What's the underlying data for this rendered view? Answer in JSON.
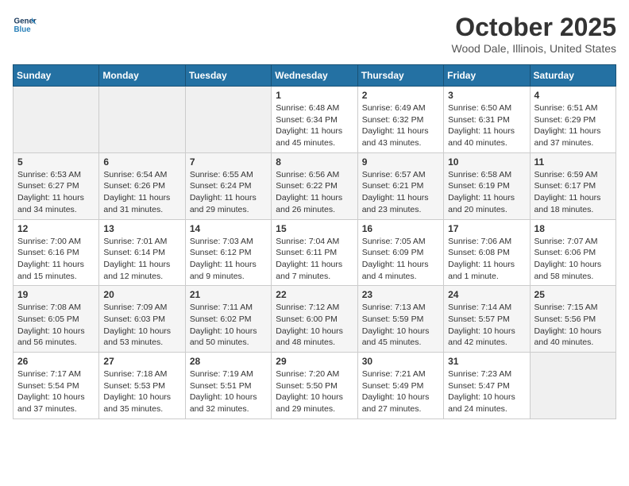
{
  "header": {
    "logo_line1": "General",
    "logo_line2": "Blue",
    "month_title": "October 2025",
    "location": "Wood Dale, Illinois, United States"
  },
  "days_of_week": [
    "Sunday",
    "Monday",
    "Tuesday",
    "Wednesday",
    "Thursday",
    "Friday",
    "Saturday"
  ],
  "weeks": [
    [
      {
        "day": "",
        "info": ""
      },
      {
        "day": "",
        "info": ""
      },
      {
        "day": "",
        "info": ""
      },
      {
        "day": "1",
        "info": "Sunrise: 6:48 AM\nSunset: 6:34 PM\nDaylight: 11 hours and 45 minutes."
      },
      {
        "day": "2",
        "info": "Sunrise: 6:49 AM\nSunset: 6:32 PM\nDaylight: 11 hours and 43 minutes."
      },
      {
        "day": "3",
        "info": "Sunrise: 6:50 AM\nSunset: 6:31 PM\nDaylight: 11 hours and 40 minutes."
      },
      {
        "day": "4",
        "info": "Sunrise: 6:51 AM\nSunset: 6:29 PM\nDaylight: 11 hours and 37 minutes."
      }
    ],
    [
      {
        "day": "5",
        "info": "Sunrise: 6:53 AM\nSunset: 6:27 PM\nDaylight: 11 hours and 34 minutes."
      },
      {
        "day": "6",
        "info": "Sunrise: 6:54 AM\nSunset: 6:26 PM\nDaylight: 11 hours and 31 minutes."
      },
      {
        "day": "7",
        "info": "Sunrise: 6:55 AM\nSunset: 6:24 PM\nDaylight: 11 hours and 29 minutes."
      },
      {
        "day": "8",
        "info": "Sunrise: 6:56 AM\nSunset: 6:22 PM\nDaylight: 11 hours and 26 minutes."
      },
      {
        "day": "9",
        "info": "Sunrise: 6:57 AM\nSunset: 6:21 PM\nDaylight: 11 hours and 23 minutes."
      },
      {
        "day": "10",
        "info": "Sunrise: 6:58 AM\nSunset: 6:19 PM\nDaylight: 11 hours and 20 minutes."
      },
      {
        "day": "11",
        "info": "Sunrise: 6:59 AM\nSunset: 6:17 PM\nDaylight: 11 hours and 18 minutes."
      }
    ],
    [
      {
        "day": "12",
        "info": "Sunrise: 7:00 AM\nSunset: 6:16 PM\nDaylight: 11 hours and 15 minutes."
      },
      {
        "day": "13",
        "info": "Sunrise: 7:01 AM\nSunset: 6:14 PM\nDaylight: 11 hours and 12 minutes."
      },
      {
        "day": "14",
        "info": "Sunrise: 7:03 AM\nSunset: 6:12 PM\nDaylight: 11 hours and 9 minutes."
      },
      {
        "day": "15",
        "info": "Sunrise: 7:04 AM\nSunset: 6:11 PM\nDaylight: 11 hours and 7 minutes."
      },
      {
        "day": "16",
        "info": "Sunrise: 7:05 AM\nSunset: 6:09 PM\nDaylight: 11 hours and 4 minutes."
      },
      {
        "day": "17",
        "info": "Sunrise: 7:06 AM\nSunset: 6:08 PM\nDaylight: 11 hours and 1 minute."
      },
      {
        "day": "18",
        "info": "Sunrise: 7:07 AM\nSunset: 6:06 PM\nDaylight: 10 hours and 58 minutes."
      }
    ],
    [
      {
        "day": "19",
        "info": "Sunrise: 7:08 AM\nSunset: 6:05 PM\nDaylight: 10 hours and 56 minutes."
      },
      {
        "day": "20",
        "info": "Sunrise: 7:09 AM\nSunset: 6:03 PM\nDaylight: 10 hours and 53 minutes."
      },
      {
        "day": "21",
        "info": "Sunrise: 7:11 AM\nSunset: 6:02 PM\nDaylight: 10 hours and 50 minutes."
      },
      {
        "day": "22",
        "info": "Sunrise: 7:12 AM\nSunset: 6:00 PM\nDaylight: 10 hours and 48 minutes."
      },
      {
        "day": "23",
        "info": "Sunrise: 7:13 AM\nSunset: 5:59 PM\nDaylight: 10 hours and 45 minutes."
      },
      {
        "day": "24",
        "info": "Sunrise: 7:14 AM\nSunset: 5:57 PM\nDaylight: 10 hours and 42 minutes."
      },
      {
        "day": "25",
        "info": "Sunrise: 7:15 AM\nSunset: 5:56 PM\nDaylight: 10 hours and 40 minutes."
      }
    ],
    [
      {
        "day": "26",
        "info": "Sunrise: 7:17 AM\nSunset: 5:54 PM\nDaylight: 10 hours and 37 minutes."
      },
      {
        "day": "27",
        "info": "Sunrise: 7:18 AM\nSunset: 5:53 PM\nDaylight: 10 hours and 35 minutes."
      },
      {
        "day": "28",
        "info": "Sunrise: 7:19 AM\nSunset: 5:51 PM\nDaylight: 10 hours and 32 minutes."
      },
      {
        "day": "29",
        "info": "Sunrise: 7:20 AM\nSunset: 5:50 PM\nDaylight: 10 hours and 29 minutes."
      },
      {
        "day": "30",
        "info": "Sunrise: 7:21 AM\nSunset: 5:49 PM\nDaylight: 10 hours and 27 minutes."
      },
      {
        "day": "31",
        "info": "Sunrise: 7:23 AM\nSunset: 5:47 PM\nDaylight: 10 hours and 24 minutes."
      },
      {
        "day": "",
        "info": ""
      }
    ]
  ]
}
